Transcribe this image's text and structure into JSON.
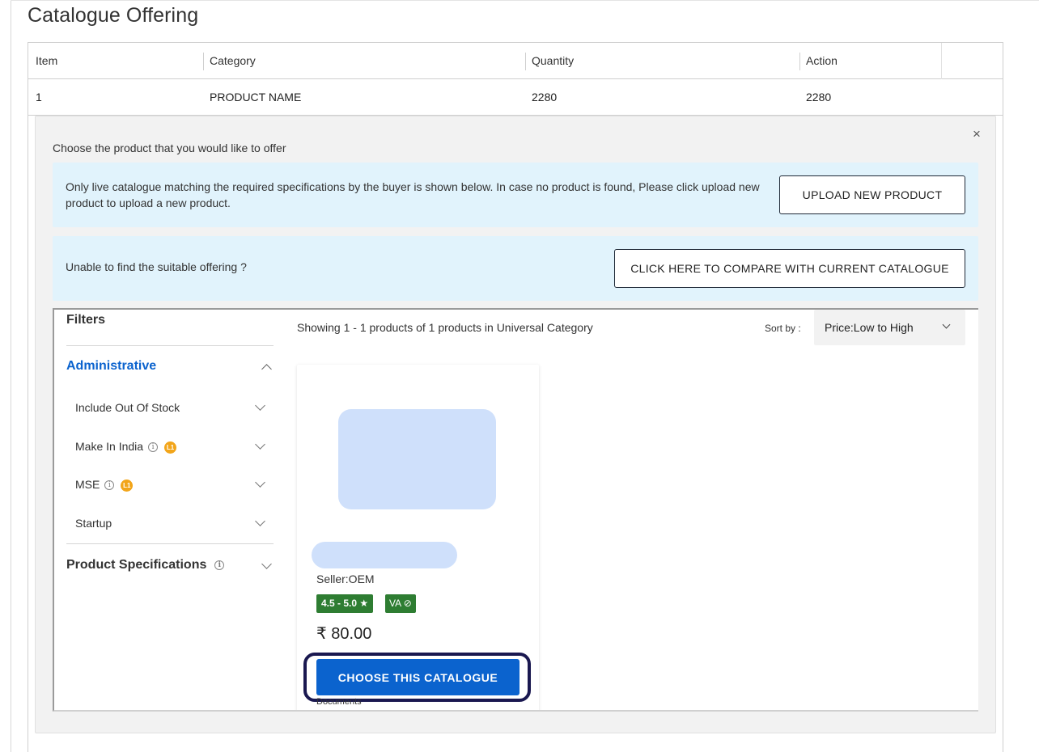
{
  "page": {
    "title": "Catalogue Offering"
  },
  "table": {
    "headers": [
      "Item",
      "Category",
      "Quantity",
      "Action"
    ],
    "rows": [
      {
        "item": "1",
        "category": "PRODUCT NAME",
        "quantity": "2280",
        "action": "2280"
      }
    ]
  },
  "panel": {
    "close_icon": "×",
    "prompt": "Choose the product that you would like to offer",
    "info_text": "Only live catalogue matching the required specifications by the buyer is shown below. In case no product is found, Please click upload new product to upload a new product.",
    "upload_button": "UPLOAD NEW PRODUCT",
    "compare_prompt": "Unable to find the suitable offering ?",
    "compare_button": "CLICK HERE TO COMPARE WITH CURRENT CATALOGUE"
  },
  "filters": {
    "title": "Filters",
    "administrative": {
      "label": "Administrative",
      "items": [
        {
          "label": "Include Out Of Stock"
        },
        {
          "label": "Make In India",
          "badge": "L1"
        },
        {
          "label": "MSE",
          "badge": "L1"
        },
        {
          "label": "Startup"
        }
      ]
    },
    "product_specifications": {
      "label": "Product Specifications"
    }
  },
  "results": {
    "showing_text": "Showing 1 - 1 products of 1 products in Universal Category",
    "sort_label": "Sort by :",
    "sort_value": "Price:Low to High"
  },
  "product": {
    "seller": "Seller:OEM",
    "rating": "4.5 - 5.0 ★",
    "va_badge": "VA ⊘",
    "price": "₹ 80.00",
    "choose_button": "CHOOSE THIS CATALOGUE",
    "documents": "Documents"
  },
  "colors": {
    "accent": "#0b63ce",
    "info_bg": "#e1f3fc",
    "badge_green": "#2e7d32",
    "l1_orange": "#f2a51a",
    "placeholder_blue": "#cfe0fb",
    "highlight_ring": "#1a1850"
  }
}
